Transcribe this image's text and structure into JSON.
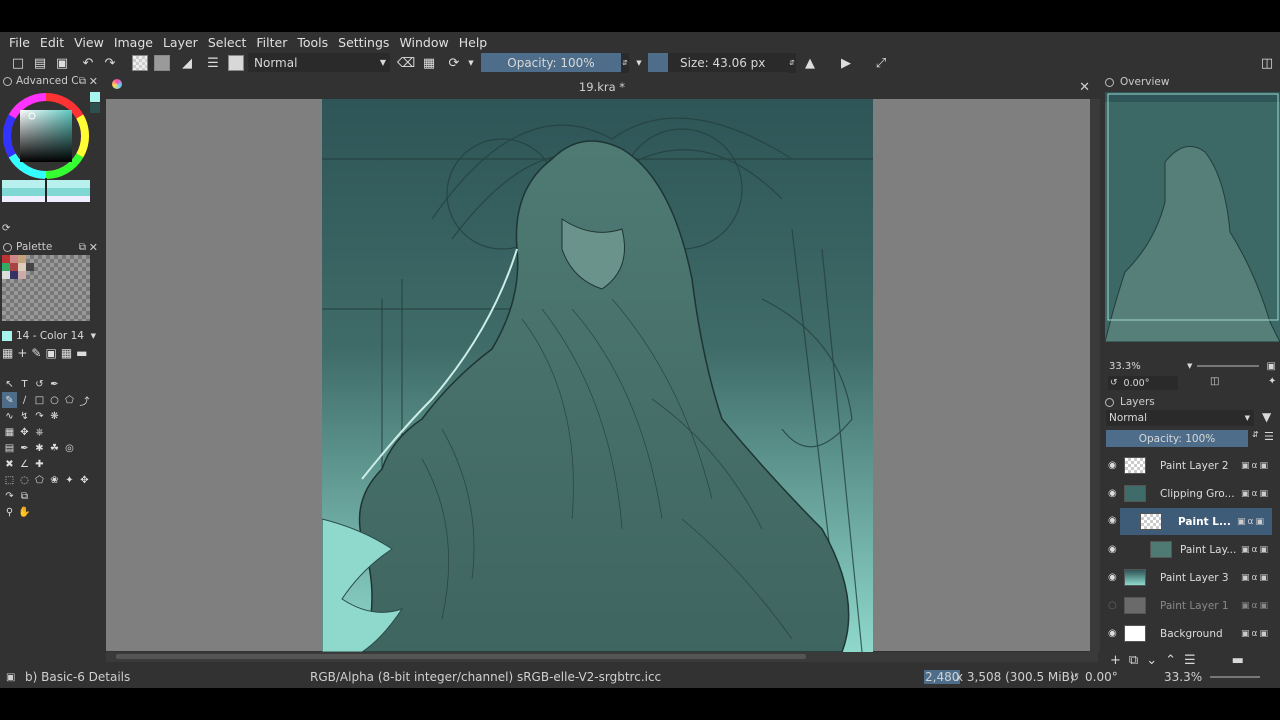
{
  "menu": [
    "File",
    "Edit",
    "View",
    "Image",
    "Layer",
    "Select",
    "Filter",
    "Tools",
    "Settings",
    "Window",
    "Help"
  ],
  "toolbar": {
    "blend_mode": "Normal",
    "opacity": "Opacity: 100%",
    "size": "Size: 43.06 px"
  },
  "left_dock": {
    "color_panel_title": "Advanced C",
    "palette_title": "Palette",
    "palette_color": "14 - Color 14"
  },
  "canvas": {
    "title": "19.kra *"
  },
  "overview": {
    "title": "Overview",
    "zoom": "33.3%",
    "rotation": "0.00°"
  },
  "layers": {
    "title": "Layers",
    "blend_mode": "Normal",
    "opacity": "Opacity:  100%",
    "items": [
      {
        "name": "Paint Layer 2",
        "selected": false,
        "visible": true
      },
      {
        "name": "Clipping Gro...",
        "selected": false,
        "visible": true
      },
      {
        "name": "Paint L...",
        "selected": true,
        "visible": true
      },
      {
        "name": "Paint Lay...",
        "selected": false,
        "visible": true
      },
      {
        "name": "Paint Layer 3",
        "selected": false,
        "visible": true
      },
      {
        "name": "Paint Layer 1",
        "selected": false,
        "visible": false
      },
      {
        "name": "Background",
        "selected": false,
        "visible": true
      }
    ]
  },
  "status": {
    "brush": "b) Basic-6 Details",
    "color_space": "RGB/Alpha (8-bit integer/channel)  sRGB-elle-V2-srgbtrc.icc",
    "dim_highlight": "2,480",
    "dimensions": " x 3,508 (300.5 MiB)",
    "rotation": "0.00°",
    "zoom": "33.3%"
  },
  "colors": {
    "accent": "#4d6d8a",
    "canvas_bg": "#7f7f7f",
    "panel_bg": "#323232",
    "art_teal": "#3f6b68"
  }
}
